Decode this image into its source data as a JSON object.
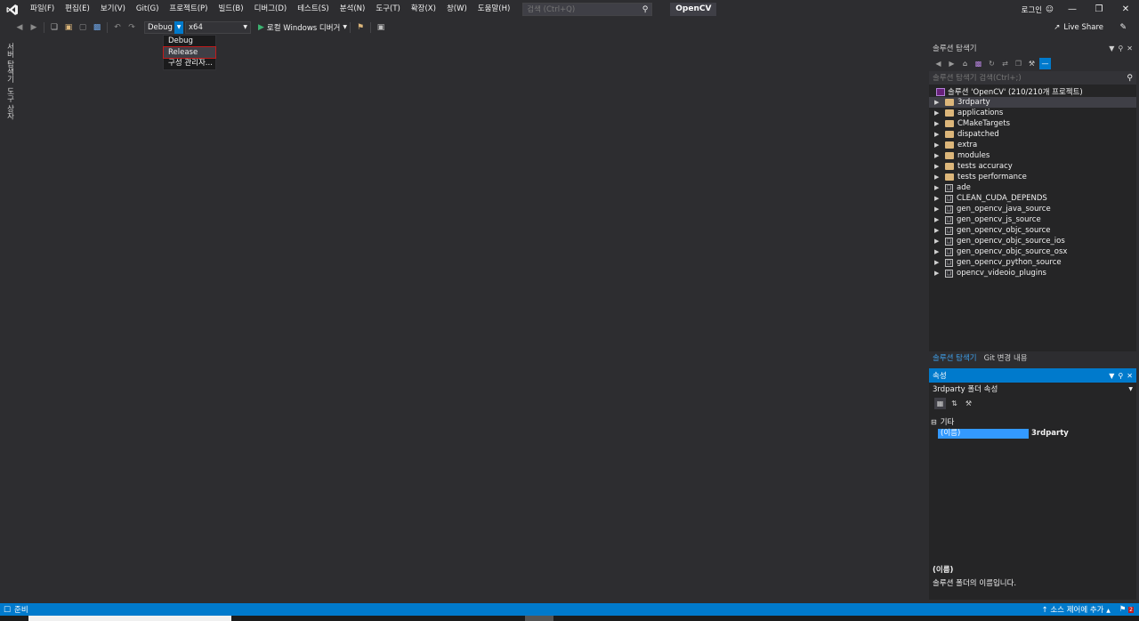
{
  "menu": {
    "items": [
      "파일(F)",
      "편집(E)",
      "보기(V)",
      "Git(G)",
      "프로젝트(P)",
      "빌드(B)",
      "디버그(D)",
      "테스트(S)",
      "분석(N)",
      "도구(T)",
      "확장(X)",
      "창(W)",
      "도움말(H)"
    ],
    "search_placeholder": "검색 (Ctrl+Q)",
    "solution_name": "OpenCV",
    "login_label": "로그인"
  },
  "toolbar": {
    "config_value": "Debug",
    "platform_value": "x64",
    "run_label": "로컬 Windows 디버거",
    "live_share_label": "Live Share"
  },
  "config_dropdown": {
    "options": [
      "Debug",
      "Release",
      "구성 관리자..."
    ],
    "highlighted": "Release"
  },
  "left_tabs": [
    "서버 탐색기",
    "도구 상자"
  ],
  "solution_explorer": {
    "title": "솔루션 탐색기",
    "search_placeholder": "솔루션 탐색기 검색(Ctrl+;)",
    "root_label": "솔루션 'OpenCV' (210/210개 프로젝트)",
    "folders": [
      "3rdparty",
      "applications",
      "CMakeTargets",
      "dispatched",
      "extra",
      "modules",
      "tests accuracy",
      "tests performance"
    ],
    "projects": [
      "ade",
      "CLEAN_CUDA_DEPENDS",
      "gen_opencv_java_source",
      "gen_opencv_js_source",
      "gen_opencv_objc_source",
      "gen_opencv_objc_source_ios",
      "gen_opencv_objc_source_osx",
      "gen_opencv_python_source",
      "opencv_videoio_plugins"
    ]
  },
  "panel_tabs": {
    "tab1": "솔루션 탐색기",
    "tab2": "Git 변경 내용"
  },
  "properties": {
    "title": "속성",
    "object_label": "3rdparty 폴더 속성",
    "category": "기타",
    "prop_name": "(이름)",
    "prop_value": "3rdparty",
    "desc_title": "(이름)",
    "desc_text": "솔루션 폴더의 이름입니다."
  },
  "statusbar": {
    "ready": "준비",
    "source_control": "소스 제어에 추가",
    "notification_count": "2"
  },
  "colors": {
    "accent": "#007acc",
    "background": "#2d2d30",
    "highlight_border": "#c21b1b",
    "folder": "#dcb67a"
  }
}
